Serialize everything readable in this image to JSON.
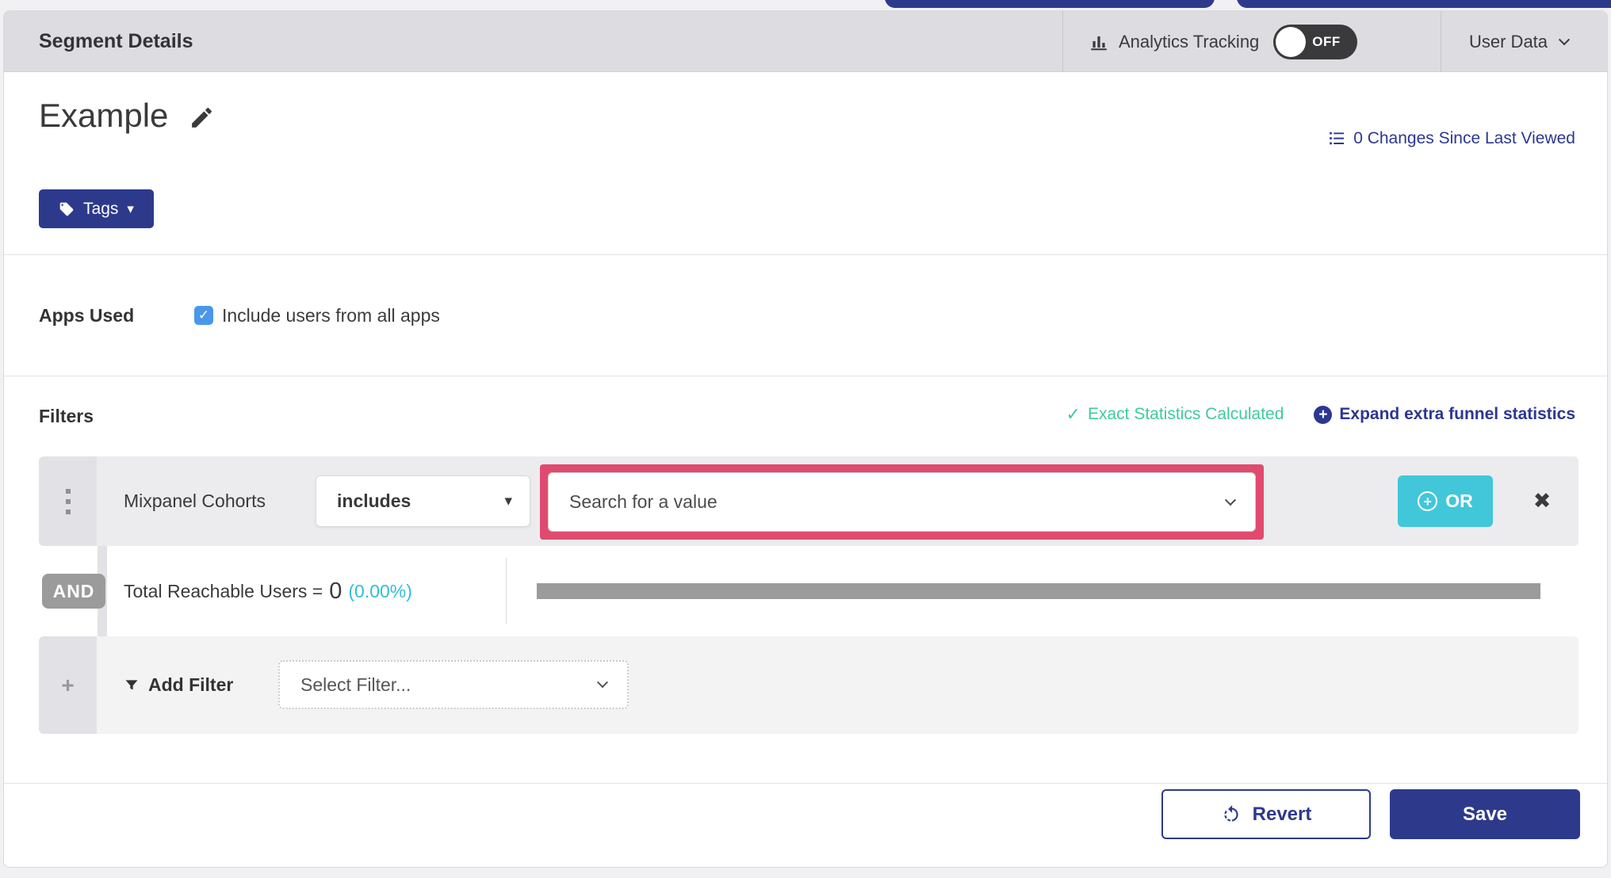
{
  "header": {
    "title": "Segment Details",
    "analytics_tracking": {
      "label": "Analytics Tracking",
      "toggle_state": "OFF"
    },
    "user_data": {
      "label": "User Data"
    }
  },
  "segment": {
    "name": "Example",
    "tags_button": "Tags",
    "changes_link": "0 Changes Since Last Viewed"
  },
  "apps_used": {
    "label": "Apps Used",
    "include_all_label": "Include users from all apps",
    "checked": true
  },
  "filters": {
    "title": "Filters",
    "exact_statistics": "Exact Statistics Calculated",
    "expand_link": "Expand extra funnel statistics",
    "filter_row": {
      "field": "Mixpanel Cohorts",
      "operator": "includes",
      "value_placeholder": "Search for a value",
      "or_button": "OR"
    },
    "connector": "AND",
    "reachable": {
      "label": "Total Reachable Users =",
      "count": "0",
      "percent": "(0.00%)"
    },
    "add_filter": {
      "label": "Add Filter",
      "placeholder": "Select Filter..."
    }
  },
  "footer": {
    "revert": "Revert",
    "save": "Save"
  },
  "icons": {
    "check": "✓",
    "close": "✖",
    "plus": "+",
    "caret_down": "▾"
  },
  "colors": {
    "indigo": "#2d3a8c",
    "link_indigo": "#2c3792",
    "teal_or": "#41c7d9",
    "cyan_percent": "#2fc0d6",
    "green_exact": "#3eca9e",
    "pink_highlight": "#e14a6f",
    "checkbox_blue": "#4a97e8",
    "header_gray": "#dcdce1",
    "bar_gray": "#9b9b9b"
  }
}
